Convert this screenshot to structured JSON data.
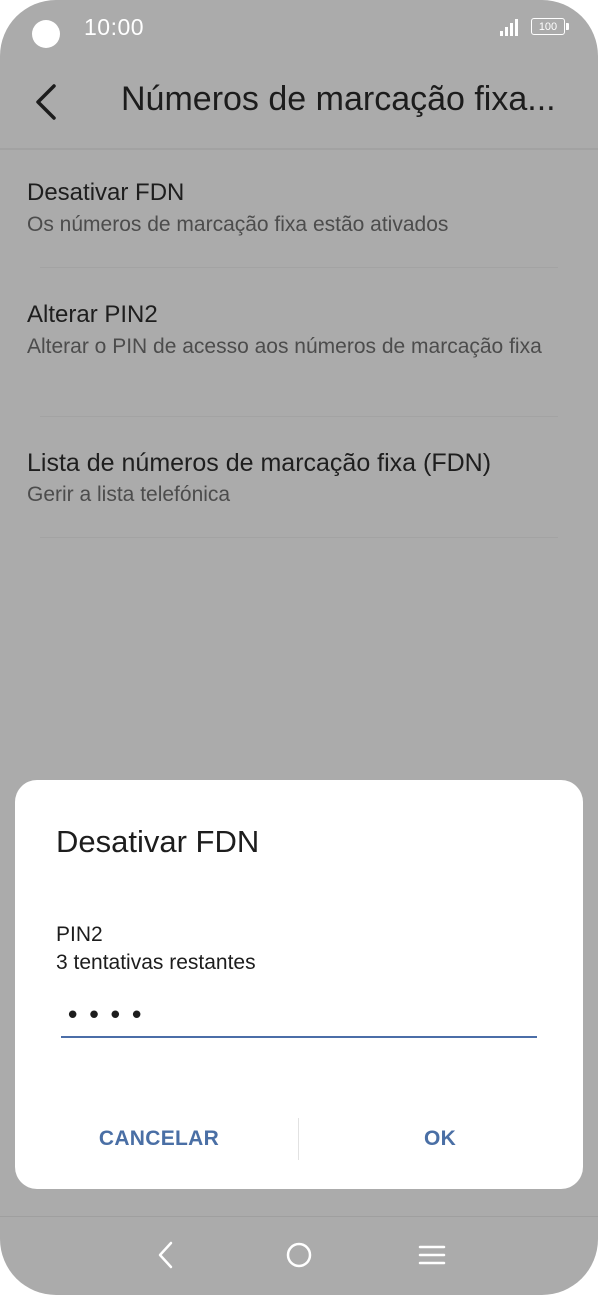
{
  "status_bar": {
    "time": "10:00",
    "battery": "100",
    "icons": [
      "camera-cutout",
      "signal-icon",
      "battery-icon"
    ]
  },
  "header": {
    "title": "Números de marcação fixa...",
    "back_icon": "chevron-left-icon"
  },
  "settings": {
    "items": [
      {
        "title": "Desativar FDN",
        "subtitle": "Os números de marcação fixa estão ativados"
      },
      {
        "title": "Alterar PIN2",
        "subtitle": "Alterar o PIN de acesso aos números de marcação fixa"
      },
      {
        "title": "Lista de números de marcação fixa (FDN)",
        "subtitle": "Gerir a lista telefónica"
      }
    ]
  },
  "dialog": {
    "title": "Desativar FDN",
    "pin_label": "PIN2",
    "attempts": "3 tentativas restantes",
    "pin_value": "••••",
    "cancel_label": "CANCELAR",
    "ok_label": "OK",
    "accent_color": "#4a6fa5"
  },
  "nav_bar": {
    "icons": [
      "back-icon",
      "home-icon",
      "menu-icon"
    ]
  }
}
